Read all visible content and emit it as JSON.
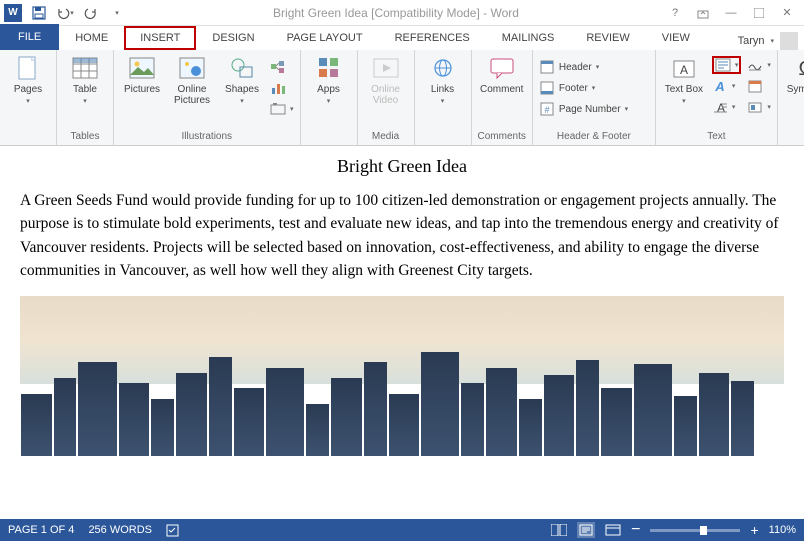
{
  "titlebar": {
    "title": "Bright Green Idea [Compatibility Mode] - Word",
    "user": "Taryn"
  },
  "tabs": {
    "file": "FILE",
    "items": [
      "HOME",
      "INSERT",
      "DESIGN",
      "PAGE LAYOUT",
      "REFERENCES",
      "MAILINGS",
      "REVIEW",
      "VIEW"
    ],
    "active": "INSERT"
  },
  "ribbon": {
    "pages": {
      "btn": "Pages"
    },
    "tables": {
      "btn": "Table",
      "label": "Tables"
    },
    "illustrations": {
      "pictures": "Pictures",
      "online_pictures": "Online Pictures",
      "shapes": "Shapes",
      "label": "Illustrations"
    },
    "apps": {
      "btn": "Apps"
    },
    "media": {
      "btn": "Online Video",
      "label": "Media"
    },
    "links": {
      "btn": "Links"
    },
    "comments": {
      "btn": "Comment",
      "label": "Comments"
    },
    "headerfooter": {
      "header": "Header",
      "footer": "Footer",
      "pagenum": "Page Number",
      "label": "Header & Footer"
    },
    "text": {
      "textbox": "Text Box",
      "label": "Text"
    },
    "symbols": {
      "btn": "Symbols"
    }
  },
  "document": {
    "title": "Bright Green Idea",
    "body": "A Green Seeds Fund would provide funding for up to 100 citizen-led demonstration or engagement projects annually. The purpose is to stimulate bold experiments, test and evaluate new ideas, and tap into the tremendous energy and creativity of Vancouver residents. Projects will be selected based on innovation, cost-effectiveness, and ability to engage the diverse communities in Vancouver, as well how well they align with Greenest City targets."
  },
  "statusbar": {
    "page": "PAGE 1 OF 4",
    "words": "256 WORDS",
    "zoom": "110%"
  }
}
